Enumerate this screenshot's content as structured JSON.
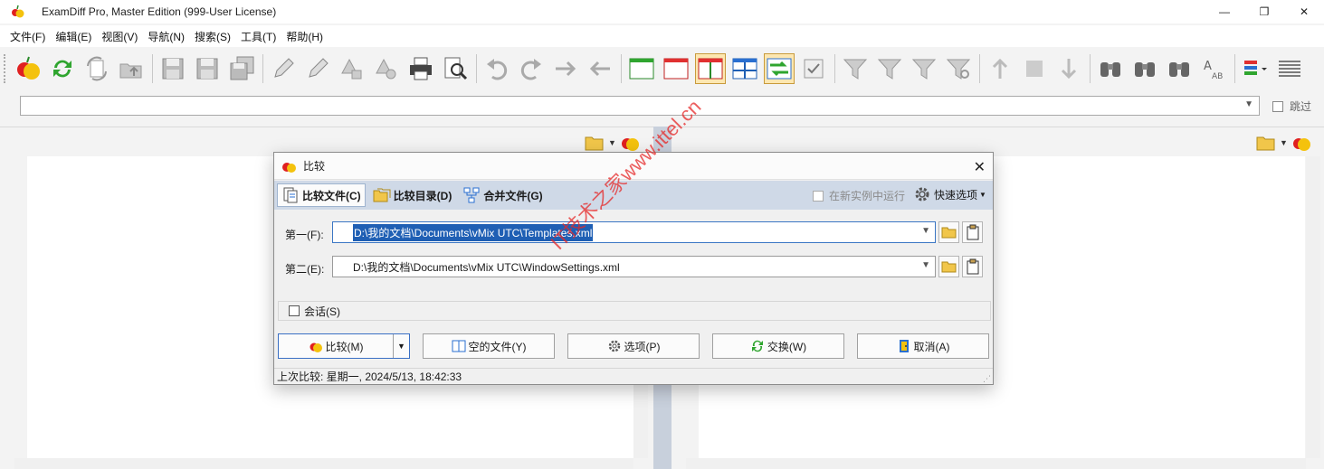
{
  "window": {
    "title": "ExamDiff Pro, Master Edition (999-User License)",
    "minimize": "—",
    "restore": "❐",
    "close": "✕"
  },
  "menu": [
    "文件(F)",
    "编辑(E)",
    "视图(V)",
    "导航(N)",
    "搜索(S)",
    "工具(T)",
    "帮助(H)"
  ],
  "toolbar": {
    "active": [
      "layout-split-vertical",
      "sync-scroll"
    ]
  },
  "pathbar": {
    "value": "",
    "skip_label": "跳过"
  },
  "dialog": {
    "title": "比较",
    "tabs": [
      {
        "label": "比较文件(C)",
        "active": true
      },
      {
        "label": "比较目录(D)",
        "active": false
      },
      {
        "label": "合并文件(G)",
        "active": false
      }
    ],
    "new_instance_label": "在新实例中运行",
    "quick_options_label": "快速选项",
    "first_label": "第一(F):",
    "first_value": "D:\\我的文档\\Documents\\vMix UTC\\Templates.xml",
    "second_label": "第二(E):",
    "second_value": "D:\\我的文档\\Documents\\vMix UTC\\WindowSettings.xml",
    "session_label": "会话(S)",
    "buttons": {
      "compare": "比较(M)",
      "empty": "空的文件(Y)",
      "options": "选项(P)",
      "swap": "交换(W)",
      "cancel": "取消(A)"
    },
    "status": "上次比较:  星期一, 2024/5/13, 18:42:33"
  },
  "watermark": "IT技术之家www.ittel.cn",
  "colors": {
    "accent": "#1f5fb4",
    "tab_band": "#cfd9e7",
    "active_tool": "#fde7b1"
  }
}
